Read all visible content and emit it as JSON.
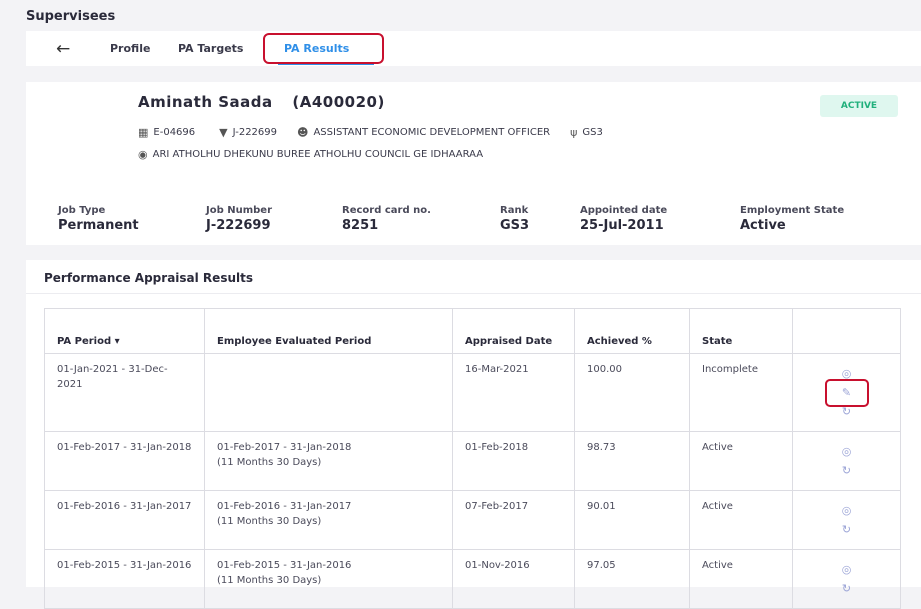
{
  "page": {
    "title": "Supervisees"
  },
  "nav": {
    "back_icon": "arrow-left-icon",
    "tabs": [
      {
        "label": "Profile",
        "active": false
      },
      {
        "label": "PA Targets",
        "active": false
      },
      {
        "label": "PA Results",
        "active": true
      }
    ]
  },
  "employee": {
    "name": "Aminath Saada",
    "code": "(A400020)",
    "status": "ACTIVE",
    "employee_no": "E-04696",
    "job_no": "J-222699",
    "designation": "ASSISTANT ECONOMIC DEVELOPMENT OFFICER",
    "grade": "GS3",
    "workplace": "ARI ATHOLHU DHEKUNU BUREE ATHOLHU COUNCIL GE IDHAARAA"
  },
  "summary": [
    {
      "label": "Job Type",
      "value": "Permanent"
    },
    {
      "label": "Job Number",
      "value": "J-222699"
    },
    {
      "label": "Record card no.",
      "value": "8251"
    },
    {
      "label": "Rank",
      "value": "GS3"
    },
    {
      "label": "Appointed date",
      "value": "25-Jul-2011"
    },
    {
      "label": "Employment State",
      "value": "Active"
    }
  ],
  "results": {
    "title": "Performance Appraisal Results",
    "columns": [
      "PA Period ▾",
      "Employee Evaluated Period",
      "Appraised Date",
      "Achieved %",
      "State",
      ""
    ],
    "rows": [
      {
        "period": "01-Jan-2021 - 31-Dec-2021",
        "evaluated": "",
        "evaluated_duration": "",
        "appraised": "16-Mar-2021",
        "achieved": "100.00",
        "state": "Incomplete"
      },
      {
        "period": "01-Feb-2017 - 31-Jan-2018",
        "evaluated": "01-Feb-2017 - 31-Jan-2018",
        "evaluated_duration": "(11 Months 30 Days)",
        "appraised": "01-Feb-2018",
        "achieved": "98.73",
        "state": "Active"
      },
      {
        "period": "01-Feb-2016 - 31-Jan-2017",
        "evaluated": "01-Feb-2016 - 31-Jan-2017",
        "evaluated_duration": "(11 Months 30 Days)",
        "appraised": "07-Feb-2017",
        "achieved": "90.01",
        "state": "Active"
      },
      {
        "period": "01-Feb-2015 - 31-Jan-2016",
        "evaluated": "01-Feb-2015 - 31-Jan-2016",
        "evaluated_duration": "(11 Months 30 Days)",
        "appraised": "01-Nov-2016",
        "achieved": "97.05",
        "state": "Active"
      }
    ]
  },
  "colors": {
    "accent": "#2f8fe8",
    "highlight": "#c8102e",
    "active_badge_bg": "#dff7ef",
    "active_badge_text": "#21b07c",
    "action_icon": "#9aa3d6"
  }
}
